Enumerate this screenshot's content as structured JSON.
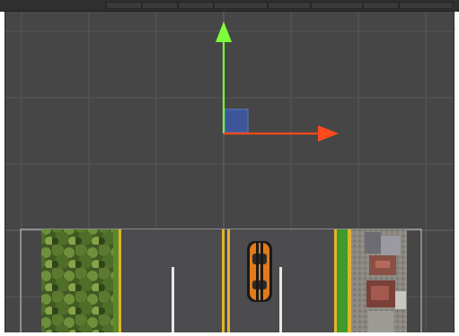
{
  "window": {
    "panel": "scene-view"
  },
  "toolbar": {
    "visible_text": "",
    "background": "#2f2f2f"
  },
  "scene": {
    "background": "#464646",
    "grid_color": "#575757",
    "selected_object": "car-sprite"
  },
  "gizmo": {
    "type": "move-tool",
    "x_axis_color": "#ff4a1c",
    "y_axis_color": "#7dff3a",
    "plane_handle_color": "#3b59a8"
  },
  "road": {
    "lanes": 4,
    "center_line_color": "#e2b22c",
    "edge_line_color": "#e2b22c",
    "lane_marker_color": "#e8e8e8",
    "asphalt_color": "#4c4c4f",
    "left_verge": "trees",
    "right_verge": "buildings"
  },
  "car": {
    "color": "#e07a1a",
    "stripe_color": "#1a1a1a",
    "direction": "up"
  }
}
